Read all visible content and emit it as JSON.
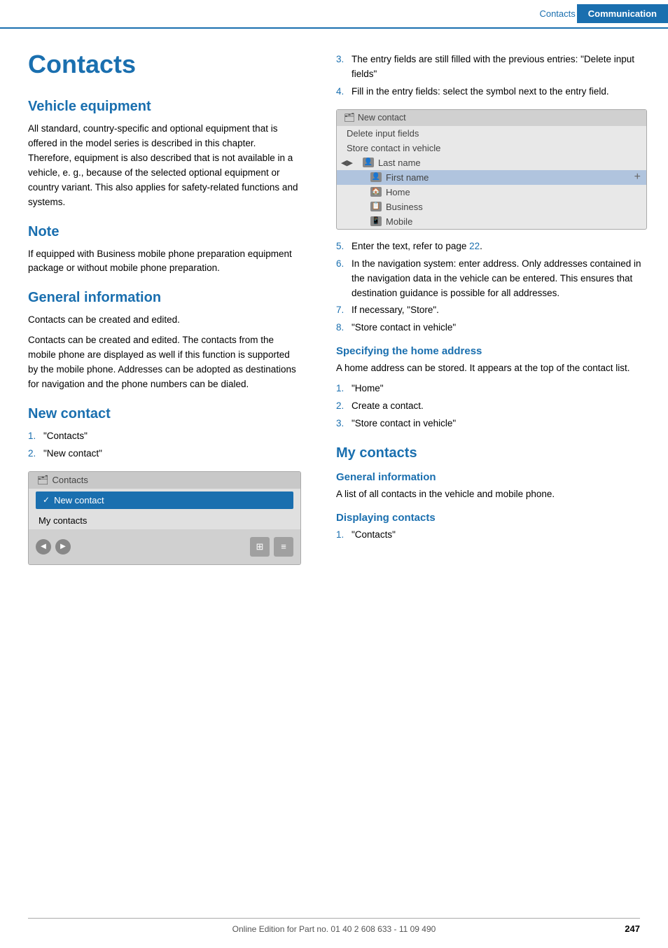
{
  "header": {
    "contacts_label": "Contacts",
    "communication_label": "Communication"
  },
  "main_title": "Contacts",
  "left_col": {
    "vehicle_equipment": {
      "heading": "Vehicle equipment",
      "body": "All standard, country-specific and optional equipment that is offered in the model series is described in this chapter. Therefore, equipment is also described that is not available in a vehicle, e. g., because of the selected optional equipment or country variant. This also applies for safety-related functions and systems."
    },
    "note": {
      "heading": "Note",
      "body": "If equipped with Business mobile phone preparation equipment package or without mobile phone preparation."
    },
    "general_information": {
      "heading": "General information",
      "body1": "Contacts can be created and edited.",
      "body2": "Contacts can be created and edited. The contacts from the mobile phone are displayed as well if this function is supported by the mobile phone. Addresses can be adopted as destinations for navigation and the phone numbers can be dialed."
    },
    "new_contact": {
      "heading": "New contact",
      "steps": [
        {
          "num": "1.",
          "text": "\"Contacts\""
        },
        {
          "num": "2.",
          "text": "\"New contact\""
        }
      ],
      "screenshot": {
        "title": "Contacts",
        "items": [
          {
            "label": "New contact",
            "selected": true,
            "check": true
          },
          {
            "label": "My contacts",
            "selected": false,
            "check": false
          }
        ]
      }
    }
  },
  "right_col": {
    "steps_3_to_8": [
      {
        "num": "3.",
        "text": "The entry fields are still filled with the previous entries: \"Delete input fields\""
      },
      {
        "num": "4.",
        "text": "Fill in the entry fields: select the symbol next to the entry field."
      }
    ],
    "new_contact_ui": {
      "title": "New contact",
      "menu_items": [
        {
          "label": "Delete input fields",
          "icon": false,
          "selected": false
        },
        {
          "label": "Store contact in vehicle",
          "icon": false,
          "selected": false
        },
        {
          "label": "Last name",
          "icon": true,
          "selected": false
        },
        {
          "label": "First name",
          "icon": true,
          "selected": true
        },
        {
          "label": "Home",
          "icon": true,
          "selected": false
        },
        {
          "label": "Business",
          "icon": true,
          "selected": false
        },
        {
          "label": "Mobile",
          "icon": true,
          "selected": false
        }
      ]
    },
    "steps_5_to_8": [
      {
        "num": "5.",
        "text": "Enter the text, refer to page ",
        "link": "22",
        "link_after": "."
      },
      {
        "num": "6.",
        "text": "In the navigation system: enter address. Only addresses contained in the navigation data in the vehicle can be entered. This ensures that destination guidance is possible for all addresses."
      },
      {
        "num": "7.",
        "text": "If necessary, \"Store\"."
      },
      {
        "num": "8.",
        "text": "\"Store contact in vehicle\""
      }
    ],
    "specifying_home_address": {
      "heading": "Specifying the home address",
      "body": "A home address can be stored. It appears at the top of the contact list.",
      "steps": [
        {
          "num": "1.",
          "text": "\"Home\""
        },
        {
          "num": "2.",
          "text": "Create a contact."
        },
        {
          "num": "3.",
          "text": "\"Store contact in vehicle\""
        }
      ]
    },
    "my_contacts": {
      "heading": "My contacts",
      "general_info": {
        "subheading": "General information",
        "body": "A list of all contacts in the vehicle and mobile phone."
      },
      "displaying_contacts": {
        "subheading": "Displaying contacts",
        "steps": [
          {
            "num": "1.",
            "text": "\"Contacts\""
          }
        ]
      }
    }
  },
  "footer": {
    "text": "Online Edition for Part no. 01 40 2 608 633 - 11 09 490",
    "page_number": "247"
  }
}
